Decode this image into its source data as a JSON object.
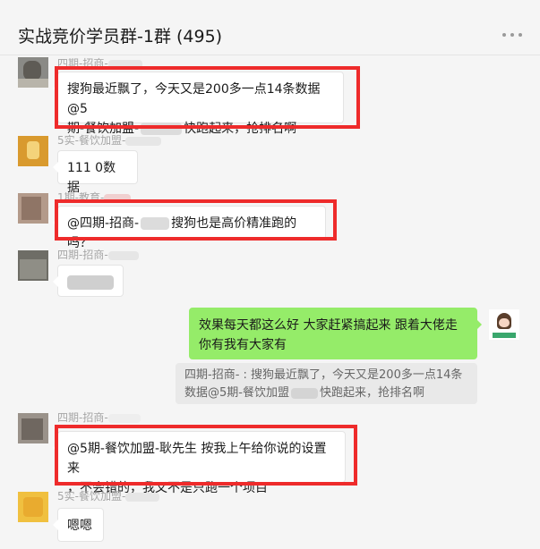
{
  "header": {
    "title": "实战竞价学员群-1群 (495)"
  },
  "messages": [
    {
      "sender": "四期-招商-",
      "text_line1": "搜狗最近飘了，今天又是200多一点14条数据@5",
      "text_line2a": "期-餐饮加盟-",
      "text_line2b": "快跑起来，抢排名啊"
    },
    {
      "sender": "5实-餐饮加盟-",
      "text": "111  0数据"
    },
    {
      "sender": "1期-教育-",
      "text_a": "@四期-招商-",
      "text_b": "搜狗也是高价精准跑的吗？"
    },
    {
      "sender": "四期-招商-"
    },
    {
      "text_line1": "效果每天都这么好    大家赶紧搞起来 跟着大佬走",
      "text_line2": "你有我有大家有",
      "quote_line1": "四期-招商-       : 搜狗最近飘了，今天又是200多一点14条",
      "quote_line2a": "数据@5期-餐饮加盟",
      "quote_line2b": "快跑起来，抢排名啊"
    },
    {
      "sender": "四期-招商-",
      "text_line1": "@5期-餐饮加盟-耿先生 按我上午给你说的设置来",
      "text_line2": "，不会错的，我又不是只跑一个项目"
    },
    {
      "sender": "5实-餐饮加盟-",
      "text": "嗯嗯"
    }
  ],
  "colors": {
    "highlight": "#ee2b2b",
    "self_bubble": "#95ec69",
    "background": "#f5f5f5"
  }
}
